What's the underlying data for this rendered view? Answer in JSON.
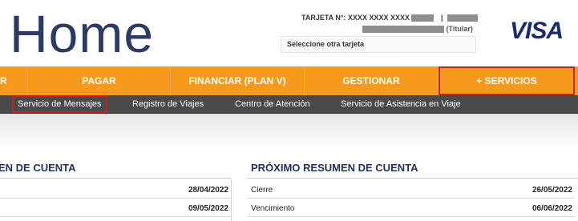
{
  "header": {
    "title": "Home",
    "card_label": "TARJETA N°: XXXX XXXX XXXX",
    "card_separator": "|",
    "card_holder": "(Titular)",
    "card_select": "Seleccione otra tarjeta",
    "brand_logo": "VISA"
  },
  "main_nav": {
    "items": [
      {
        "label": "R"
      },
      {
        "label": "PAGAR"
      },
      {
        "label": "FINANCIAR (PLAN V)"
      },
      {
        "label": "GESTIONAR"
      },
      {
        "label": "+ SERVICIOS"
      }
    ]
  },
  "sub_nav": {
    "items": [
      {
        "label": "Servicio de Mensajes"
      },
      {
        "label": "Registro de Viajes"
      },
      {
        "label": "Centro de Atención"
      },
      {
        "label": "Servicio de Asistencia en Viaje"
      }
    ]
  },
  "left_summary": {
    "title": "EN DE CUENTA",
    "rows": [
      {
        "label": "",
        "value": "28/04/2022"
      },
      {
        "label": "",
        "value": "09/05/2022"
      }
    ]
  },
  "right_summary": {
    "title": "PRÓXIMO RESUMEN DE CUENTA",
    "rows": [
      {
        "label": "Cierre",
        "value": "26/05/2022"
      },
      {
        "label": "Vencimiento",
        "value": "06/06/2022"
      }
    ]
  },
  "colors": {
    "nav_orange": "#f79a1b",
    "subnav_dark": "#4a4a4a",
    "highlight_red": "#c62020",
    "title_navy": "#2d3a63"
  }
}
